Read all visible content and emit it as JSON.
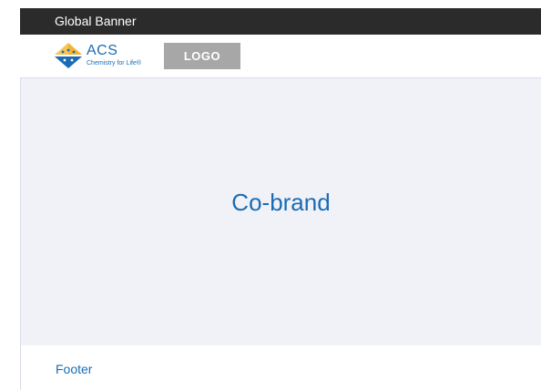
{
  "banner": {
    "label": "Global Banner"
  },
  "header": {
    "brand_name": "ACS",
    "brand_tagline": "Chemistry for Life®",
    "logo_placeholder": "LOGO"
  },
  "main": {
    "cobrand_label": "Co-brand"
  },
  "footer": {
    "label": "Footer"
  },
  "colors": {
    "banner_bg": "#2b2b2b",
    "brand_blue": "#1a6cb5",
    "brand_gold": "#f5b335",
    "logo_placeholder_bg": "#a7a7a7",
    "cobrand_bg": "#f1f2f8"
  },
  "icons": {
    "brand_mark": "acs-hexagon-logo-icon"
  }
}
